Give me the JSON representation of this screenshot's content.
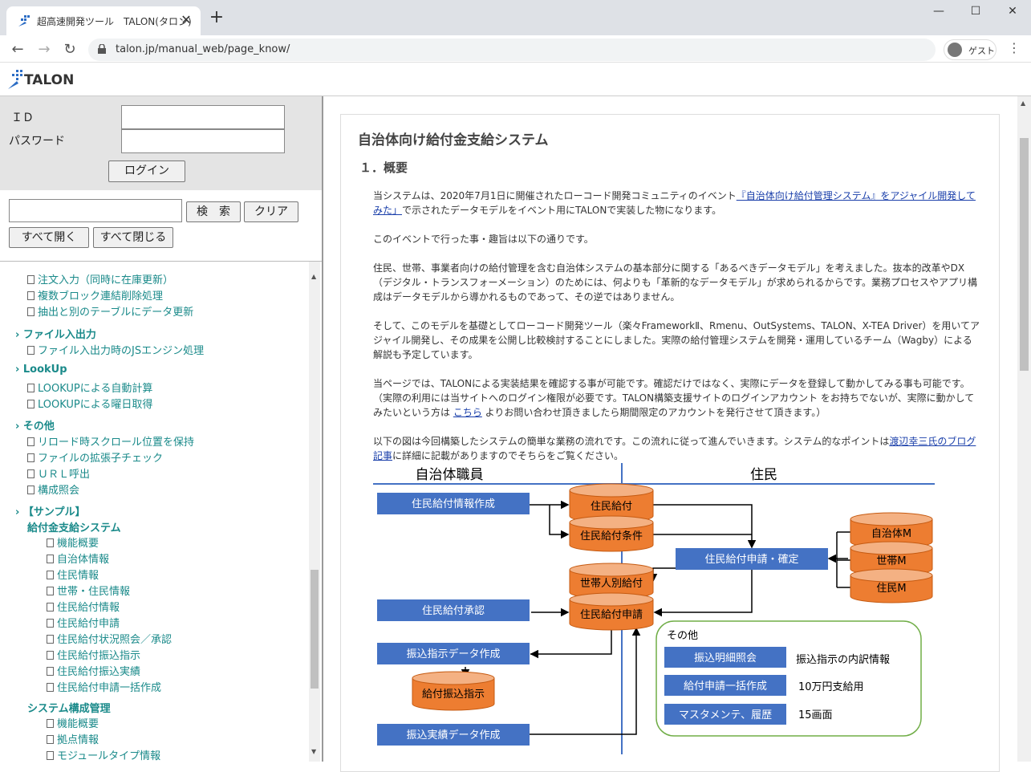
{
  "browser": {
    "tab_title": "超高速開発ツール　TALON(タロン)",
    "url": "talon.jp/manual_web/page_know/",
    "guest_label": "ゲスト"
  },
  "site": {
    "logo_text": "TALON"
  },
  "login": {
    "id_label": "ＩＤ",
    "password_label": "パスワード",
    "login_button": "ログイン"
  },
  "search": {
    "search_button": "検　索",
    "clear_button": "クリア",
    "expand_all": "すべて開く",
    "collapse_all": "すべて閉じる"
  },
  "tree": {
    "items_top": [
      "注文入力（同時に在庫更新）",
      "複数ブロック連結削除処理",
      "抽出と別のテーブルにデータ更新"
    ],
    "cat_file": "ファイル入出力",
    "file_items": [
      "ファイル入出力時のJSエンジン処理"
    ],
    "cat_lookup": "LookUp",
    "lookup_items": [
      "LOOKUPによる自動計算",
      "LOOKUPによる曜日取得"
    ],
    "cat_other": "その他",
    "other_items": [
      "リロード時スクロール位置を保持",
      "ファイルの拡張子チェック",
      "ＵＲＬ呼出",
      "構成照会"
    ],
    "cat_sample": "【サンプル】",
    "folder1": "給付金支給システム",
    "folder1_items": [
      "機能概要",
      "自治体情報",
      "住民情報",
      "世帯・住民情報",
      "住民給付情報",
      "住民給付申請",
      "住民給付状況照会／承認",
      "住民給付振込指示",
      "住民給付振込実績",
      "住民給付申請一括作成"
    ],
    "folder2": "システム構成管理",
    "folder2_items": [
      "機能概要",
      "拠点情報",
      "モジュールタイプ情報"
    ]
  },
  "content": {
    "title": "自治体向け給付金支給システム",
    "section": "１．概要",
    "p1_a": "当システムは、2020年7月1日に開催されたローコード開発コミュニティのイベント",
    "p1_link": "『自治体向け給付管理システム』をアジャイル開発してみた」",
    "p1_b": "で示されたデータモデルをイベント用にTALONで実装した物になります。",
    "p2": "このイベントで行った事・趣旨は以下の通りです。",
    "p3": "住民、世帯、事業者向けの給付管理を含む自治体システムの基本部分に関する「あるべきデータモデル」を考えました。抜本的改革やDX（デジタル・トランスフォーメーション）のためには、何よりも「革新的なデータモデル」が求められるからです。業務プロセスやアプリ構成はデータモデルから導かれるものであって、その逆ではありません。",
    "p4": "そして、このモデルを基礎としてローコード開発ツール（楽々FrameworkⅡ、Rmenu、OutSystems、TALON、X-TEA Driver）を用いてアジャイル開発し、その成果を公開し比較検討することにしました。実際の給付管理システムを開発・運用しているチーム（Wagby）による解説も予定しています。",
    "p5_a": "当ページでは、TALONによる実装結果を確認する事が可能です。確認だけではなく、実際にデータを登録して動かしてみる事も可能です。（実際の利用には当サイトへのログイン権限が必要です。TALON構築支援サイトのログインアカウント をお持ちでないが、実際に動かしてみたいという方は ",
    "p5_link": "こちら",
    "p5_b": " よりお問い合わせ頂きましたら期間限定のアカウントを発行させて頂きます。）",
    "p6_a": "以下の図は今回構築したシステムの簡単な業務の流れです。この流れに従って進んでいきます。システム的なポイントは",
    "p6_link": "渡辺幸三氏のブログ記事",
    "p6_b": "に詳細に記載がありますのでそちらをご覧ください。"
  },
  "diagram": {
    "lane_left": "自治体職員",
    "lane_right": "住民",
    "proc1": "住民給付情報作成",
    "proc2": "住民給付承認",
    "proc3": "振込指示データ作成",
    "proc4": "振込実績データ作成",
    "proc5": "住民給付申請・確定",
    "db1": "住民給付",
    "db2": "住民給付条件",
    "db3": "世帯人別給付",
    "db4": "住民給付申請",
    "db5": "給付振込指示",
    "db6": "自治体M",
    "db7": "世帯M",
    "db8": "住民M",
    "other_title": "その他",
    "other_items": [
      {
        "label": "振込明細照会",
        "desc": "振込指示の内訳情報"
      },
      {
        "label": "給付申請一括作成",
        "desc": "10万円支給用"
      },
      {
        "label": "マスタメンテ、履歴",
        "desc": "15画面"
      }
    ],
    "colors": {
      "process": "#4472c4",
      "db": "#ed7d31",
      "lane_line": "#4472c4",
      "other_border": "#70ad47"
    }
  }
}
